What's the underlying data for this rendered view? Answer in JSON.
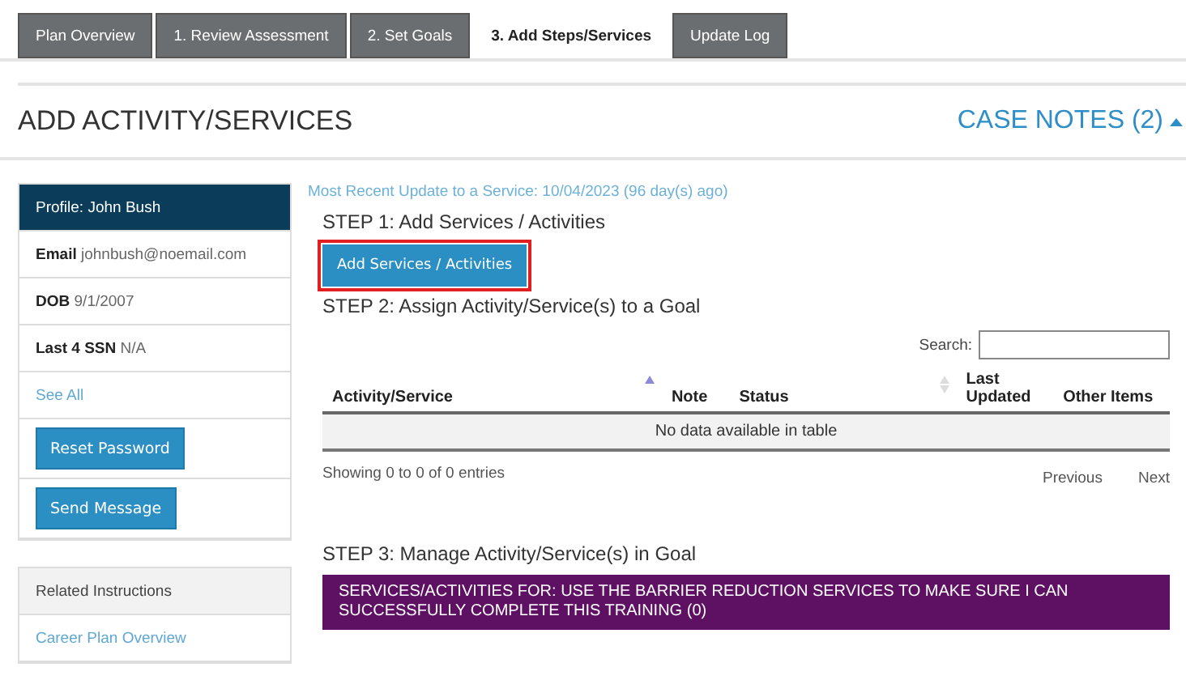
{
  "tabs": [
    {
      "label": "Plan Overview",
      "selected": false
    },
    {
      "label": "1. Review Assessment",
      "selected": false
    },
    {
      "label": "2. Set Goals",
      "selected": false
    },
    {
      "label": "3. Add Steps/Services",
      "selected": true
    },
    {
      "label": "Update Log",
      "selected": false
    }
  ],
  "page_title": "ADD ACTIVITY/SERVICES",
  "case_notes": "CASE NOTES (2)",
  "profile": {
    "header": "Profile: John Bush",
    "fields": [
      {
        "label": "Email",
        "value": "johnbush@noemail.com"
      },
      {
        "label": "DOB",
        "value": "9/1/2007"
      },
      {
        "label": "Last 4 SSN",
        "value": "N/A"
      }
    ],
    "see_all": "See All",
    "buttons": [
      "Reset Password",
      "Send Message"
    ]
  },
  "related": {
    "header": "Related Instructions",
    "links": [
      "Career Plan Overview"
    ]
  },
  "recent_update": "Most Recent Update to a Service: 10/04/2023 (96 day(s) ago)",
  "step1": {
    "heading": "STEP 1: Add Services / Activities",
    "button": "Add Services / Activities",
    "highlighted": true
  },
  "step2": {
    "heading": "STEP 2: Assign Activity/Service(s) to a Goal",
    "search_label": "Search:",
    "table": {
      "columns": [
        "Activity/Service",
        "Note",
        "Status",
        "Last Updated",
        "Other Items"
      ],
      "empty": "No data available in table"
    },
    "info": "Showing 0 to 0 of 0 entries",
    "pager": [
      "Previous",
      "Next"
    ]
  },
  "step3": {
    "heading": "STEP 3: Manage Activity/Service(s) in Goal",
    "banner": "SERVICES/ACTIVITIES FOR: USE THE BARRIER REDUCTION SERVICES TO MAKE SURE I CAN SUCCESSFULLY COMPLETE THIS TRAINING (0)"
  }
}
